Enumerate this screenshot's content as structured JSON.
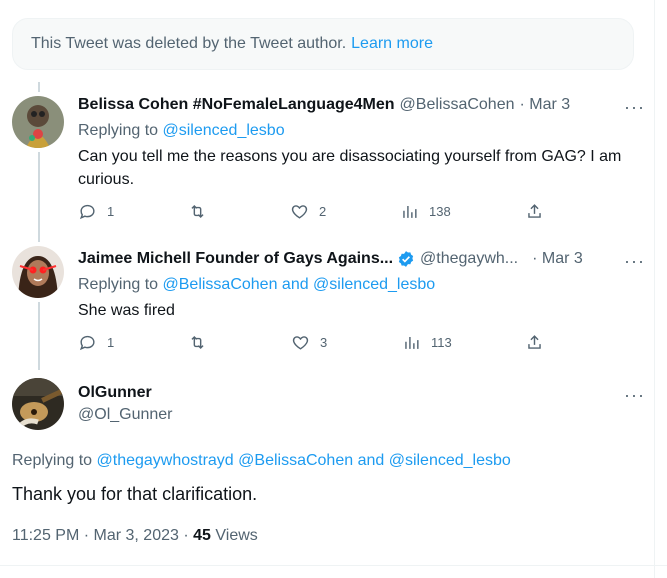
{
  "deleted_notice": {
    "text": "This Tweet was deleted by the Tweet author.",
    "link": "Learn more"
  },
  "tweets": [
    {
      "name": "Belissa Cohen #NoFemaleLanguage4Men",
      "handle": "@BelissaCohen",
      "date": "· Mar 3",
      "replying_label": "Replying to",
      "replying_to": "@silenced_lesbo",
      "text": "Can you tell me the reasons you are disassociating yourself from GAG? I am curious.",
      "replies": "1",
      "retweets": "",
      "likes": "2",
      "views": "138"
    },
    {
      "name": "Jaimee Michell Founder of Gays Agains...",
      "verified": true,
      "handle": "@thegaywh...",
      "date": "· Mar 3",
      "replying_label": "Replying to",
      "replying_to": "@BelissaCohen and @silenced_lesbo",
      "text": "She was fired",
      "replies": "1",
      "retweets": "",
      "likes": "3",
      "views": "113"
    }
  ],
  "main_tweet": {
    "name": "OlGunner",
    "handle": "@Ol_Gunner",
    "replying_label": "Replying to",
    "replying_to": "@thegaywhostrayd @BelissaCohen and @silenced_lesbo",
    "text": "Thank you for that clarification.",
    "timestamp": "11:25 PM · Mar 3, 2023 ·",
    "views_count": "45",
    "views_label": "Views"
  },
  "icons": {
    "more": "more-icon",
    "reply": "reply-icon",
    "retweet": "retweet-icon",
    "like": "heart-icon",
    "views": "views-icon",
    "share": "share-icon",
    "verified": "verified-badge-icon"
  },
  "colors": {
    "accent": "#1d9bf0",
    "muted": "#536471",
    "text": "#0f1419"
  }
}
